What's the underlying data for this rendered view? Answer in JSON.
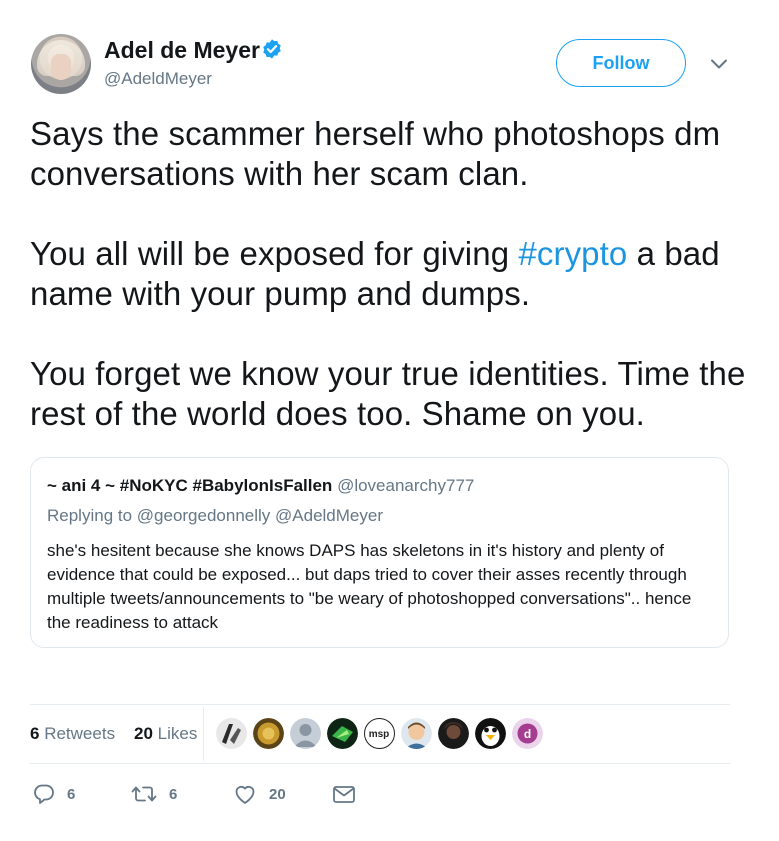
{
  "author": {
    "name": "Adel de Meyer",
    "handle": "@AdeldMeyer",
    "verified": true
  },
  "follow_label": "Follow",
  "tweet": {
    "part1": "Says the scammer herself who photoshops dm conversations with her scam clan.\n\nYou all will be exposed for giving ",
    "hashtag": "#crypto",
    "part2": " a bad name with your pump and dumps.\n\nYou forget we know your true identities. Time the rest of the world does too. Shame on you."
  },
  "quoted": {
    "author_name": "~ ani 4 ~ #NoKYC #BabylonIsFallen",
    "author_handle": "@loveanarchy777",
    "replying": "Replying to @georgedonnelly @AdeldMeyer",
    "body": "she's hesitent because she knows DAPS has skeletons in it's history and plenty of evidence that could be exposed... but daps tried to cover their asses recently through multiple tweets/announcements to \"be weary of photoshopped conversations\".. hence the readiness to attack"
  },
  "stats": {
    "retweets_count": "6",
    "retweets_label": "Retweets",
    "likes_count": "20",
    "likes_label": "Likes"
  },
  "likers": [
    {
      "name": "liker-1",
      "color": "#3b3b3b"
    },
    {
      "name": "liker-2",
      "color": "#b8860b"
    },
    {
      "name": "liker-3",
      "color": "#9aa5b1"
    },
    {
      "name": "liker-4",
      "color": "#1f6b2f"
    },
    {
      "name": "liker-5",
      "color": "#ffffff",
      "text": "msp"
    },
    {
      "name": "liker-6",
      "color": "#c9a27a"
    },
    {
      "name": "liker-7",
      "color": "#2a2a2a"
    },
    {
      "name": "liker-8",
      "color": "#111111"
    },
    {
      "name": "liker-9",
      "color": "#a43d8f"
    }
  ],
  "actions": {
    "reply_count": "6",
    "retweet_count": "6",
    "like_count": "20"
  },
  "colors": {
    "accent": "#1da1f2",
    "hashtag": "#1b95e0",
    "muted": "#657786"
  }
}
